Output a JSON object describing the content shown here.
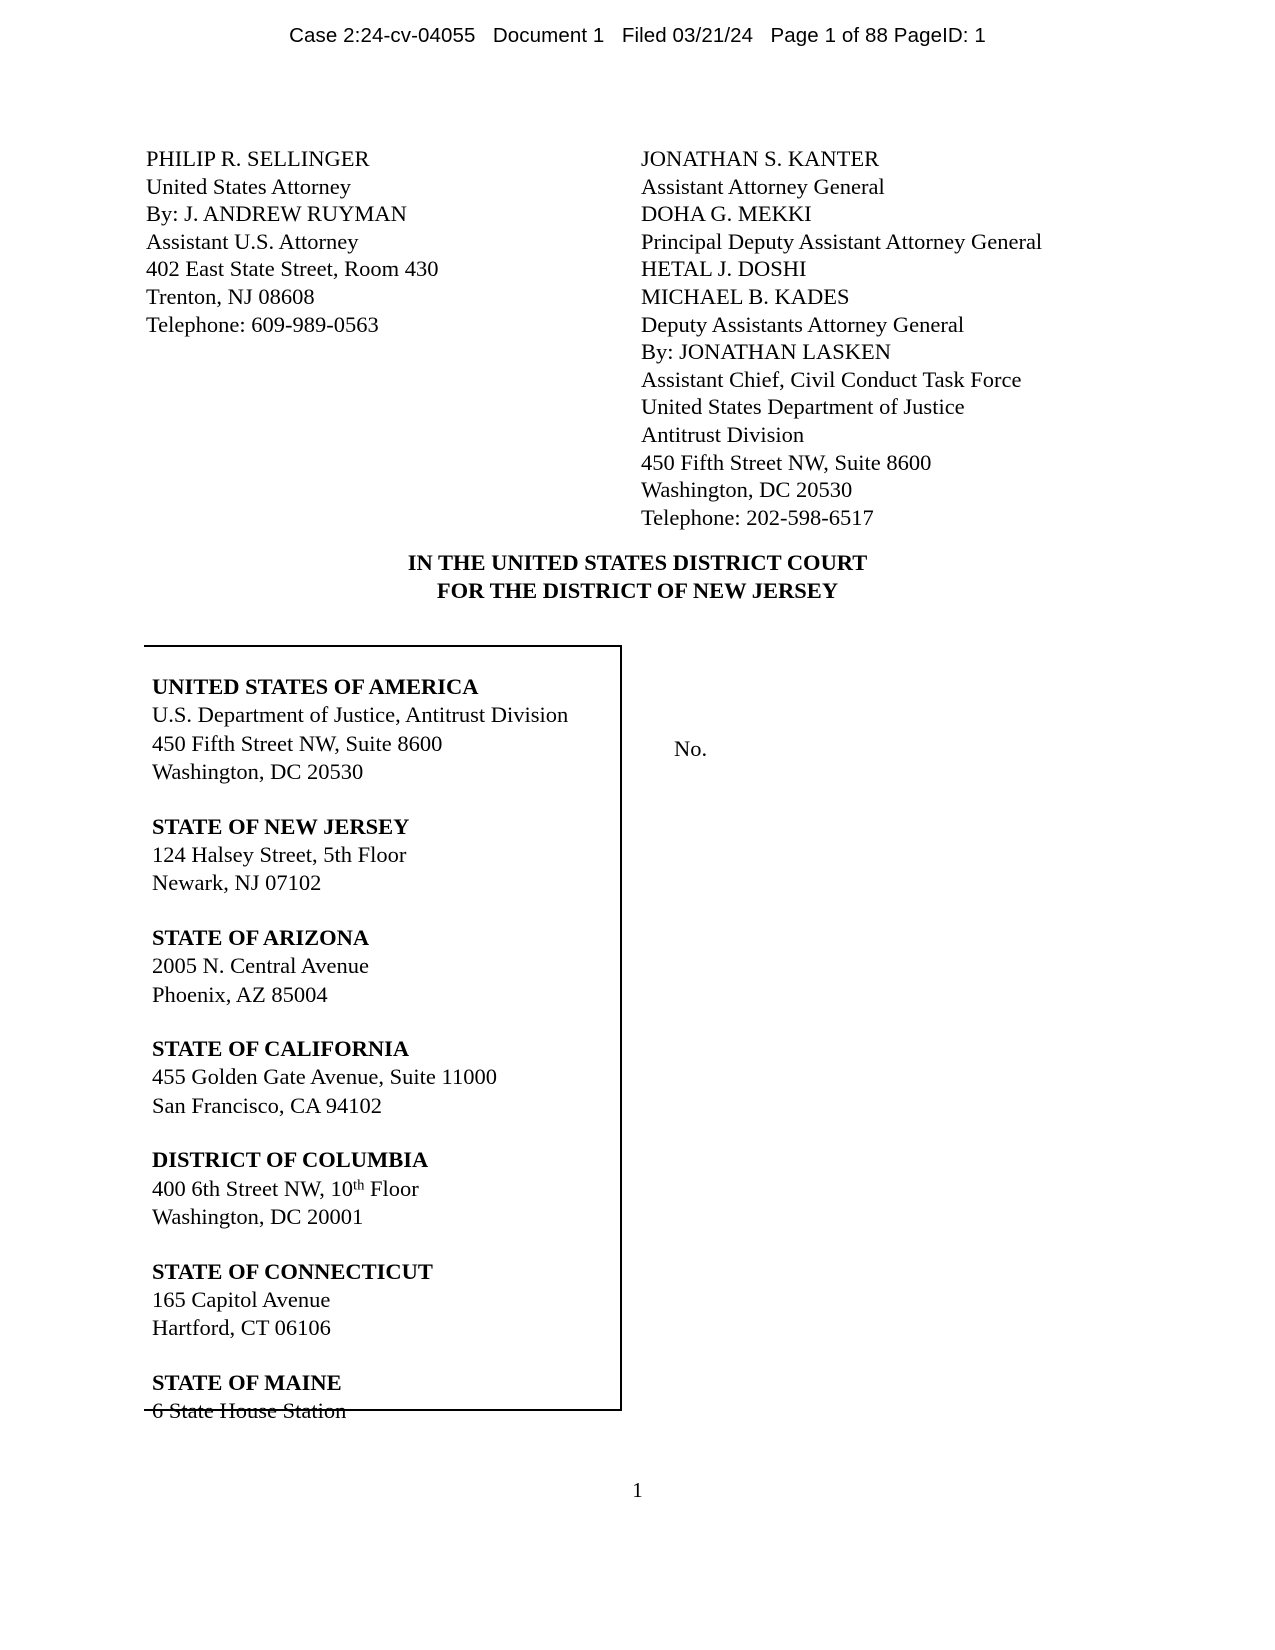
{
  "header": {
    "stamp": "Case 2:24-cv-04055   Document 1   Filed 03/21/24   Page 1 of 88 PageID: 1"
  },
  "counsel": {
    "left": [
      "PHILIP R. SELLINGER",
      "United States Attorney",
      "By: J. ANDREW RUYMAN",
      "Assistant U.S. Attorney",
      "402 East State Street, Room 430",
      "Trenton, NJ 08608",
      "Telephone: 609-989-0563"
    ],
    "right": [
      "JONATHAN S. KANTER",
      "Assistant Attorney General",
      "DOHA G. MEKKI",
      "Principal Deputy Assistant Attorney General",
      "HETAL J. DOSHI",
      "MICHAEL B. KADES",
      "Deputy Assistants Attorney General",
      "By: JONATHAN LASKEN",
      "Assistant Chief, Civil Conduct Task Force",
      "United States Department of Justice",
      "Antitrust Division",
      "450 Fifth Street NW, Suite 8600",
      "Washington, DC 20530",
      "Telephone: 202-598-6517"
    ]
  },
  "court_title": {
    "line1": "IN THE UNITED STATES DISTRICT COURT",
    "line2": "FOR THE DISTRICT OF NEW JERSEY"
  },
  "caption": {
    "case_number_label": "No.",
    "parties": [
      {
        "name": "UNITED STATES OF AMERICA",
        "lines": [
          "U.S. Department of Justice, Antitrust Division",
          "450 Fifth Street NW, Suite 8600",
          "Washington, DC 20530"
        ]
      },
      {
        "name": "STATE OF NEW JERSEY",
        "lines": [
          "124 Halsey Street, 5th Floor",
          "Newark, NJ 07102"
        ]
      },
      {
        "name": "STATE OF ARIZONA",
        "lines": [
          "2005 N. Central Avenue",
          "Phoenix, AZ 85004"
        ]
      },
      {
        "name": "STATE OF CALIFORNIA",
        "lines": [
          "455 Golden Gate Avenue, Suite 11000",
          "San Francisco, CA 94102"
        ]
      },
      {
        "name": "DISTRICT OF COLUMBIA",
        "lines": [
          "400 6th Street NW, 10<sup>th</sup> Floor",
          "Washington, DC 20001"
        ]
      },
      {
        "name": "STATE OF CONNECTICUT",
        "lines": [
          "165 Capitol Avenue",
          "Hartford, CT 06106"
        ]
      },
      {
        "name": "STATE OF MAINE",
        "lines": [
          "6 State House Station"
        ]
      }
    ]
  },
  "footer": {
    "page_number": "1"
  }
}
